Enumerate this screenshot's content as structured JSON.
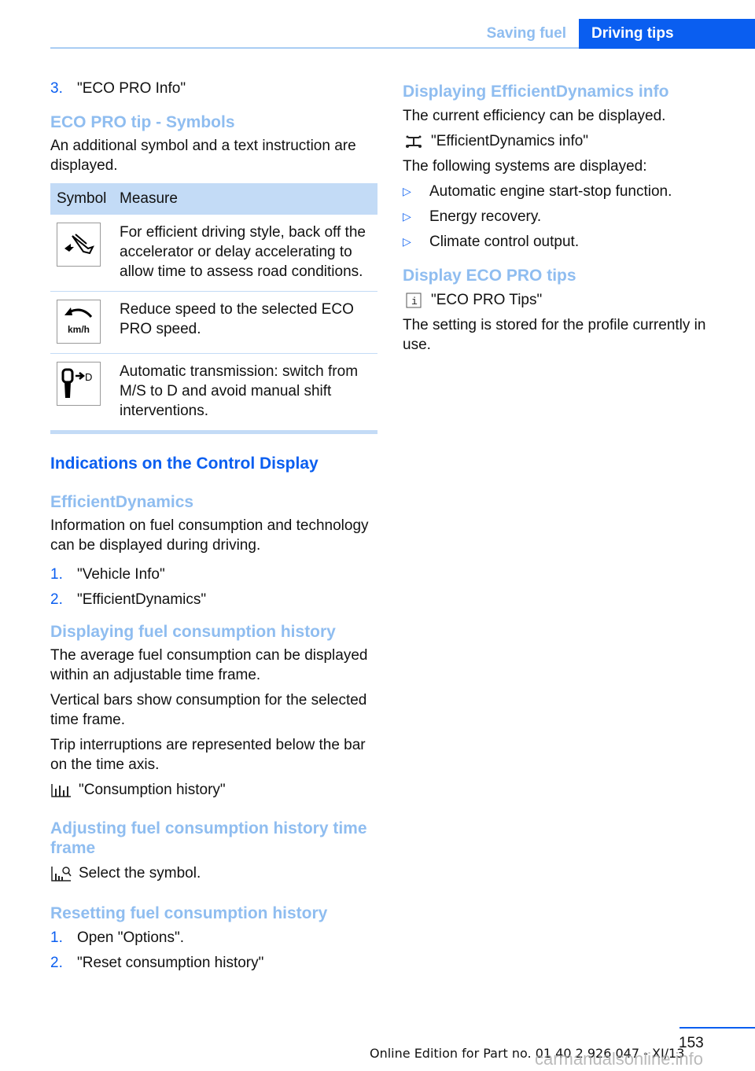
{
  "header": {
    "section_tab": "Saving fuel",
    "chapter_tab": "Driving tips"
  },
  "left": {
    "list_item_3": {
      "num": "3.",
      "text": "\"ECO PRO Info\""
    },
    "eco_tip_heading": "ECO PRO tip - Symbols",
    "eco_tip_intro": "An additional symbol and a text instruction are displayed.",
    "table": {
      "headers": [
        "Symbol",
        "Measure"
      ],
      "rows": [
        {
          "icon": "accelerator-backoff-icon",
          "measure": "For efficient driving style, back off the accelerator or delay accelerating to allow time to assess road conditions."
        },
        {
          "icon": "reduce-speed-kmh-icon",
          "icon_label": "km/h",
          "measure": "Reduce speed to the selected ECO PRO speed."
        },
        {
          "icon": "gear-selector-to-d-icon",
          "icon_label": "D",
          "measure": "Automatic transmission: switch from M/S to D and avoid manual shift interventions."
        }
      ]
    },
    "indications_heading": "Indications on the Control Display",
    "efficient_heading": "EfficientDynamics",
    "efficient_text": "Information on fuel consumption and technology can be displayed during driving.",
    "efficient_steps": [
      {
        "num": "1.",
        "text": "\"Vehicle Info\""
      },
      {
        "num": "2.",
        "text": "\"EfficientDynamics\""
      }
    ],
    "history_heading": "Displaying fuel consumption history",
    "history_p1": "The average fuel consumption can be displayed within an adjustable time frame.",
    "history_p2": "Vertical bars show consumption for the selected time frame.",
    "history_p3": "Trip interruptions are represented below the bar on the time axis.",
    "history_menu": {
      "icon": "bar-chart-icon",
      "text": "\"Consumption history\""
    },
    "adjust_heading": "Adjusting fuel consumption history time frame",
    "adjust_action": {
      "icon": "bar-chart-zoom-icon",
      "text": "Select the symbol."
    },
    "reset_heading": "Resetting fuel consumption history",
    "reset_steps": [
      {
        "num": "1.",
        "text": "Open \"Options\"."
      },
      {
        "num": "2.",
        "text": "\"Reset consumption history\""
      }
    ]
  },
  "right": {
    "display_heading": "Displaying EfficientDynamics info",
    "display_text": "The current efficiency can be displayed.",
    "display_menu": {
      "icon": "efficientdynamics-icon",
      "text": "\"EfficientDynamics info\""
    },
    "systems_intro": "The following systems are displayed:",
    "systems": [
      "Automatic engine start-stop function.",
      "Energy recovery.",
      "Climate control output."
    ],
    "tips_heading": "Display ECO PRO tips",
    "tips_menu": {
      "icon": "info-box-icon",
      "text": "\"ECO PRO Tips\""
    },
    "tips_text": "The setting is stored for the profile currently in use."
  },
  "footer": {
    "page_number": "153",
    "edition": "Online Edition for Part no. 01 40 2 926 047 - XI/13",
    "watermark": "carmanualsonline.info"
  },
  "colors": {
    "accent": "#0a5ef0",
    "subheading": "#8fbdf0",
    "table_header": "#c3dbf6"
  }
}
